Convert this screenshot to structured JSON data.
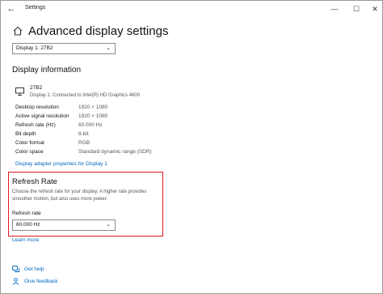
{
  "window": {
    "app_title": "Settings",
    "back_glyph": "←",
    "minimize_glyph": "—",
    "maximize_glyph": "☐",
    "close_glyph": "✕"
  },
  "header": {
    "title": "Advanced display settings",
    "icon": "home-icon"
  },
  "display_select": {
    "value": "Display 1: 27B2",
    "chevron": "⌄"
  },
  "display_info": {
    "heading": "Display information",
    "monitor_name": "27B2",
    "monitor_sub": "Display 1: Connected to Intel(R) HD Graphics 4600",
    "rows": [
      {
        "label": "Desktop resolution",
        "value": "1920 × 1080"
      },
      {
        "label": "Active signal resolution",
        "value": "1920 × 1080"
      },
      {
        "label": "Refresh rate (Hz)",
        "value": "60.000 Hz"
      },
      {
        "label": "Bit depth",
        "value": "8-bit"
      },
      {
        "label": "Color format",
        "value": "RGB"
      },
      {
        "label": "Color space",
        "value": "Standard dynamic range (SDR)"
      }
    ],
    "adapter_link": "Display adapter properties for Display 1"
  },
  "refresh_rate": {
    "heading": "Refresh Rate",
    "description": "Choose the refresh rate for your display. A higher rate provides smoother motion, but also uses more power.",
    "label": "Refresh rate",
    "value": "60.000 Hz",
    "chevron": "⌄",
    "highlight_color": "#e0171f"
  },
  "learn_more": "Learn more",
  "help": {
    "get_help": "Get help",
    "give_feedback": "Give feedback"
  },
  "colors": {
    "link": "#0067c0",
    "highlight": "#e0171f"
  }
}
